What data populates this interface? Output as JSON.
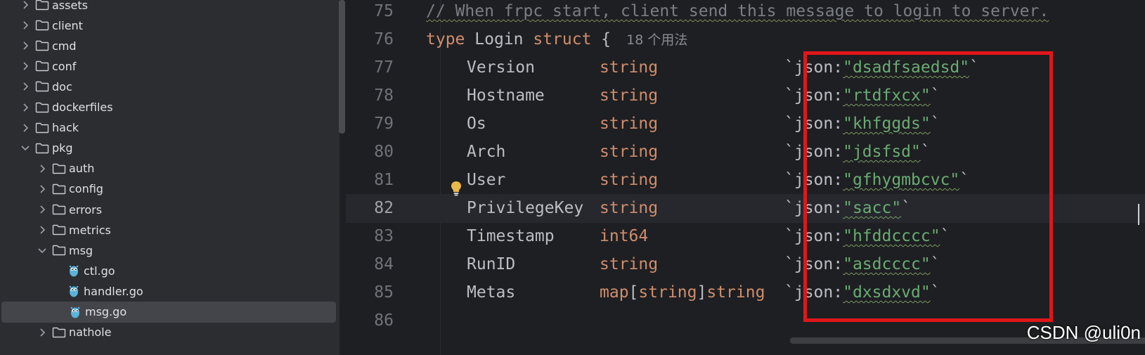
{
  "sidebar": {
    "items": [
      {
        "label": "assets",
        "kind": "folder",
        "expanded": false,
        "depth": 0
      },
      {
        "label": "client",
        "kind": "folder",
        "expanded": false,
        "depth": 0
      },
      {
        "label": "cmd",
        "kind": "folder",
        "expanded": false,
        "depth": 0
      },
      {
        "label": "conf",
        "kind": "folder",
        "expanded": false,
        "depth": 0
      },
      {
        "label": "doc",
        "kind": "folder",
        "expanded": false,
        "depth": 0
      },
      {
        "label": "dockerfiles",
        "kind": "folder",
        "expanded": false,
        "depth": 0
      },
      {
        "label": "hack",
        "kind": "folder",
        "expanded": false,
        "depth": 0
      },
      {
        "label": "pkg",
        "kind": "folder",
        "expanded": true,
        "depth": 0
      },
      {
        "label": "auth",
        "kind": "folder",
        "expanded": false,
        "depth": 1
      },
      {
        "label": "config",
        "kind": "folder",
        "expanded": false,
        "depth": 1
      },
      {
        "label": "errors",
        "kind": "folder",
        "expanded": false,
        "depth": 1
      },
      {
        "label": "metrics",
        "kind": "folder",
        "expanded": false,
        "depth": 1
      },
      {
        "label": "msg",
        "kind": "folder",
        "expanded": true,
        "depth": 1
      },
      {
        "label": "ctl.go",
        "kind": "go-file",
        "depth": 2
      },
      {
        "label": "handler.go",
        "kind": "go-file",
        "depth": 2
      },
      {
        "label": "msg.go",
        "kind": "go-file",
        "depth": 2,
        "selected": true
      },
      {
        "label": "nathole",
        "kind": "folder",
        "expanded": false,
        "depth": 1
      }
    ]
  },
  "editor": {
    "current_line": "82",
    "lines": [
      {
        "num": "75",
        "comment": "// When frpc start, client send this message to login to server."
      },
      {
        "num": "76",
        "kw": "type",
        "name": "Login",
        "kw2": "struct",
        "brace": " {",
        "hint": "18 个用法"
      },
      {
        "num": "77",
        "field": "Version",
        "type": "string",
        "tag_pre": "`json:",
        "tag_val": "\"dsadfsaedsd\"",
        "tag_post": "`"
      },
      {
        "num": "78",
        "field": "Hostname",
        "type": "string",
        "tag_pre": "`json:",
        "tag_val": "\"rtdfxcx\"",
        "tag_post": "`"
      },
      {
        "num": "79",
        "field": "Os",
        "type": "string",
        "tag_pre": "`json:",
        "tag_val": "\"khfggds\"",
        "tag_post": "`"
      },
      {
        "num": "80",
        "field": "Arch",
        "type": "string",
        "tag_pre": "`json:",
        "tag_val": "\"jdsfsd\"",
        "tag_post": "`"
      },
      {
        "num": "81",
        "field": "User",
        "type": "string",
        "tag_pre": "`json:",
        "tag_val": "\"gfhygmbcvc\"",
        "tag_post": "`"
      },
      {
        "num": "82",
        "field": "PrivilegeKey",
        "type": "string",
        "tag_pre": "`json:",
        "tag_val": "\"sacc\"",
        "tag_post": "`"
      },
      {
        "num": "83",
        "field": "Timestamp",
        "type": "int64",
        "tag_pre": "`json:",
        "tag_val": "\"hfddcccc\"",
        "tag_post": "`"
      },
      {
        "num": "84",
        "field": "RunID",
        "type": "string",
        "tag_pre": "`json:",
        "tag_val": "\"asdcccc\"",
        "tag_post": "`"
      },
      {
        "num": "85",
        "field": "Metas",
        "type_a": "map[",
        "type_b": "string",
        "type_c": "]string",
        "tag_pre": "`json:",
        "tag_val": "\"dxsdxvd\"",
        "tag_post": "`"
      },
      {
        "num": "86"
      }
    ]
  },
  "colors": {
    "comment": "#7a7e85",
    "keyword": "#cf8e6d",
    "identifier": "#bcbec4",
    "string": "#6aab73",
    "highlight_box": "#e0161a"
  },
  "icons": {
    "bulb": "lightbulb-icon",
    "folder": "folder-icon",
    "go_file": "go-gopher-icon",
    "chevron": "chevron-icon"
  },
  "watermark": "CSDN @uli0n"
}
